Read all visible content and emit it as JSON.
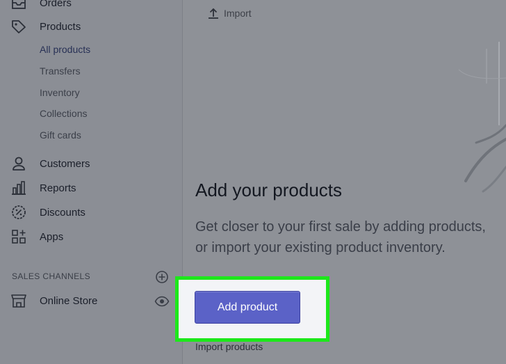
{
  "sidebar": {
    "items": [
      {
        "label": "Orders",
        "icon": "orders-icon"
      },
      {
        "label": "Products",
        "icon": "tag-icon"
      },
      {
        "label": "Customers",
        "icon": "person-icon"
      },
      {
        "label": "Reports",
        "icon": "bar-chart-icon"
      },
      {
        "label": "Discounts",
        "icon": "discount-icon"
      },
      {
        "label": "Apps",
        "icon": "apps-icon"
      }
    ],
    "sub_items": [
      "All products",
      "Transfers",
      "Inventory",
      "Collections",
      "Gift cards"
    ],
    "sales_channels_title": "SALES CHANNELS",
    "online_store_label": "Online Store"
  },
  "main": {
    "import_label": "Import",
    "heading": "Add your products",
    "description": "Get closer to your first sale by adding products, or import your existing product inventory.",
    "add_button": "Add product",
    "import_products": "Import products"
  },
  "colors": {
    "button": "#5b62c7",
    "highlight": "#1ce81a"
  }
}
